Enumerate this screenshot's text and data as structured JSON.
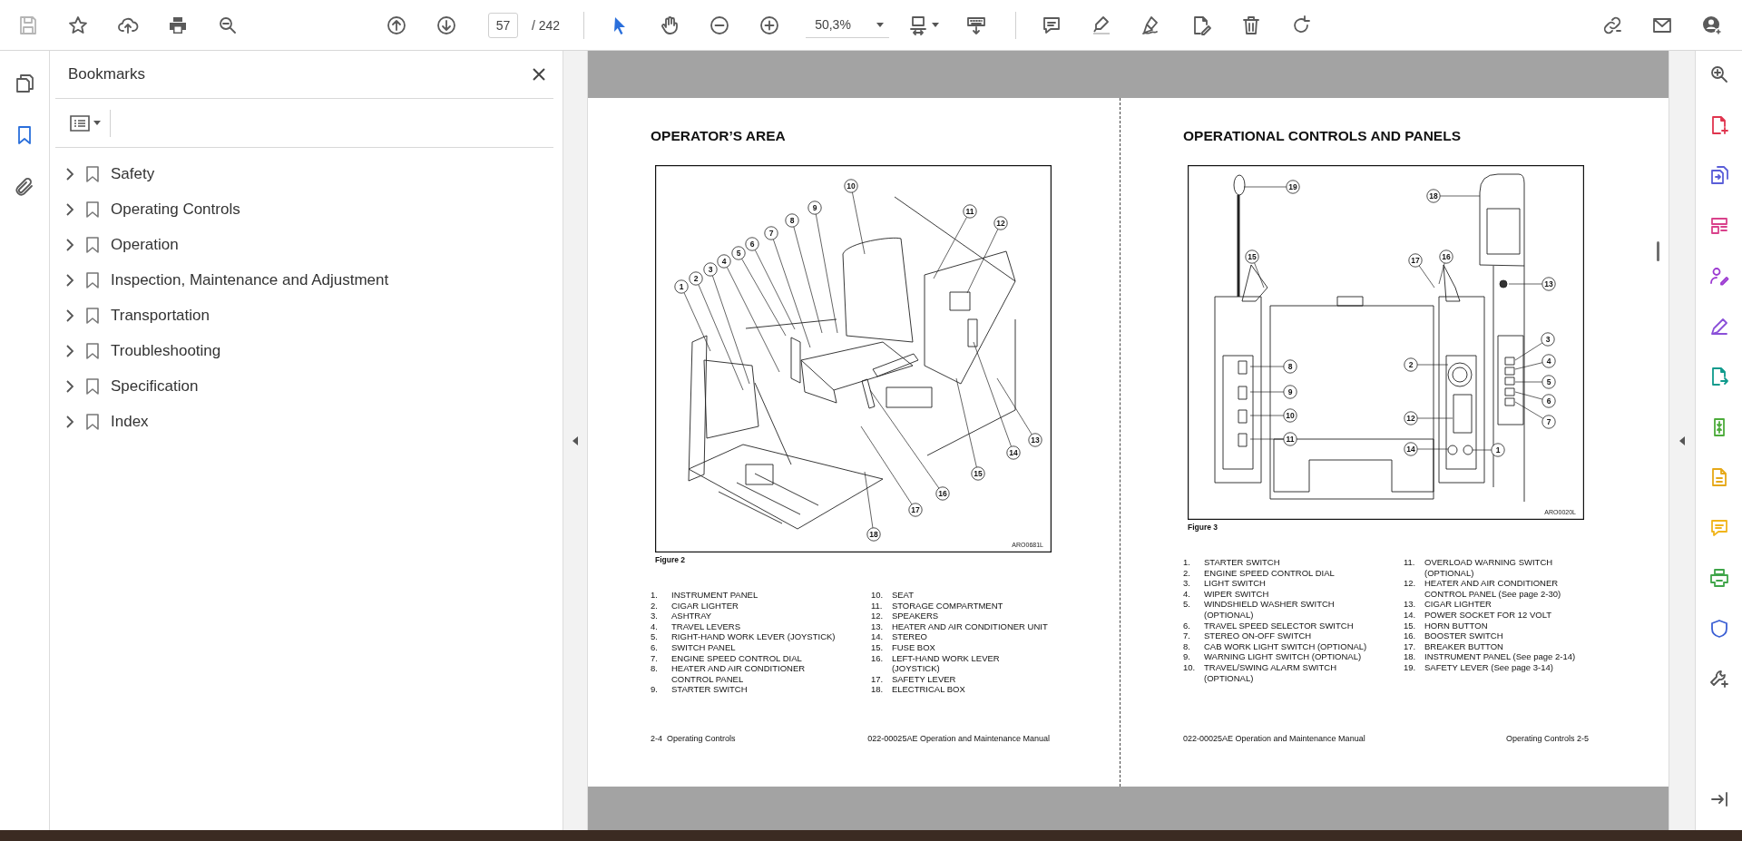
{
  "toolbar": {
    "tools": [
      {
        "kind": "select",
        "selected": true
      },
      {
        "kind": "hand",
        "selected": false
      }
    ],
    "page_number": "57",
    "page_total": "/ 242",
    "zoom": "50,3%"
  },
  "nav_rail": [
    {
      "kind": "pages",
      "selected": false
    },
    {
      "kind": "bookmarks",
      "selected": true
    },
    {
      "kind": "attachments",
      "selected": false
    }
  ],
  "bookmarks_panel": {
    "title": "Bookmarks",
    "items": [
      {
        "label": "Safety",
        "expanded": false
      },
      {
        "label": "Operating Controls",
        "expanded": false
      },
      {
        "label": "Operation",
        "expanded": false
      },
      {
        "label": "Inspection, Maintenance and Adjustment",
        "expanded": false
      },
      {
        "label": "Transportation",
        "expanded": false
      },
      {
        "label": "Troubleshooting",
        "expanded": false
      },
      {
        "label": "Specification",
        "expanded": false
      },
      {
        "label": "Index",
        "expanded": false
      }
    ]
  },
  "document": {
    "pages": [
      {
        "title": "OPERATOR’S AREA",
        "figure": {
          "kind": "cab_interior",
          "callouts": [
            "1",
            "2",
            "3",
            "4",
            "5",
            "6",
            "7",
            "8",
            "9",
            "10",
            "11",
            "12",
            "13",
            "14",
            "15",
            "16",
            "17",
            "18"
          ],
          "code": "ARO0681L",
          "caption": "Figure 2"
        },
        "legend_columns": [
          [
            {
              "number": "1.",
              "text": "INSTRUMENT PANEL"
            },
            {
              "number": "2.",
              "text": "CIGAR LIGHTER"
            },
            {
              "number": "3.",
              "text": "ASHTRAY"
            },
            {
              "number": "4.",
              "text": "TRAVEL LEVERS"
            },
            {
              "number": "5.",
              "text": "RIGHT-HAND WORK LEVER (JOYSTICK)"
            },
            {
              "number": "6.",
              "text": "SWITCH PANEL"
            },
            {
              "number": "7.",
              "text": "ENGINE SPEED CONTROL DIAL"
            },
            {
              "number": "8.",
              "text": "HEATER AND AIR CONDITIONER\nCONTROL PANEL"
            },
            {
              "number": "9.",
              "text": "STARTER SWITCH"
            }
          ],
          [
            {
              "number": "10.",
              "text": "SEAT"
            },
            {
              "number": "11.",
              "text": "STORAGE COMPARTMENT"
            },
            {
              "number": "12.",
              "text": "SPEAKERS"
            },
            {
              "number": "13.",
              "text": "HEATER AND AIR CONDITIONER UNIT"
            },
            {
              "number": "14.",
              "text": "STEREO"
            },
            {
              "number": "15.",
              "text": "FUSE BOX"
            },
            {
              "number": "16.",
              "text": "LEFT-HAND WORK LEVER (JOYSTICK)"
            },
            {
              "number": "17.",
              "text": "SAFETY LEVER"
            },
            {
              "number": "18.",
              "text": "ELECTRICAL BOX"
            }
          ]
        ],
        "footer": {
          "left": "2-4  Operating Controls",
          "right": "022-00025AE Operation and Maintenance Manual"
        }
      },
      {
        "title": "OPERATIONAL CONTROLS AND PANELS",
        "figure": {
          "kind": "control_consoles",
          "callouts": [
            "1",
            "2",
            "3",
            "4",
            "5",
            "6",
            "7",
            "8",
            "9",
            "10",
            "11",
            "12",
            "13",
            "14",
            "15",
            "16",
            "17",
            "18",
            "19"
          ],
          "code": "ARO0020L",
          "caption": "Figure 3"
        },
        "legend_columns": [
          [
            {
              "number": "1.",
              "text": "STARTER SWITCH"
            },
            {
              "number": "2.",
              "text": "ENGINE SPEED CONTROL DIAL"
            },
            {
              "number": "3.",
              "text": "LIGHT SWITCH"
            },
            {
              "number": "4.",
              "text": "WIPER SWITCH"
            },
            {
              "number": "5.",
              "text": "WINDSHIELD WASHER SWITCH\n(OPTIONAL)"
            },
            {
              "number": "6.",
              "text": "TRAVEL SPEED SELECTOR SWITCH"
            },
            {
              "number": "7.",
              "text": "STEREO ON-OFF SWITCH"
            },
            {
              "number": "8.",
              "text": "CAB WORK LIGHT SWITCH (OPTIONAL)"
            },
            {
              "number": "9.",
              "text": "WARNING LIGHT SWITCH (OPTIONAL)"
            },
            {
              "number": "10.",
              "text": "TRAVEL/SWING ALARM SWITCH\n(OPTIONAL)"
            }
          ],
          [
            {
              "number": "11.",
              "text": "OVERLOAD WARNING SWITCH\n(OPTIONAL)"
            },
            {
              "number": "12.",
              "text": "HEATER AND AIR CONDITIONER\nCONTROL PANEL (See page 2-30)"
            },
            {
              "number": "13.",
              "text": "CIGAR LIGHTER"
            },
            {
              "number": "14.",
              "text": "POWER SOCKET FOR 12 VOLT"
            },
            {
              "number": "15.",
              "text": "HORN BUTTON"
            },
            {
              "number": "16.",
              "text": "BOOSTER SWITCH"
            },
            {
              "number": "17.",
              "text": "BREAKER BUTTON"
            },
            {
              "number": "18.",
              "text": "INSTRUMENT PANEL (See page 2-14)"
            },
            {
              "number": "19.",
              "text": "SAFETY LEVER (See page 3-14)"
            }
          ]
        ],
        "footer": {
          "left": "022-00025AE Operation and Maintenance Manual",
          "right": "Operating Controls 2-5"
        }
      }
    ]
  }
}
